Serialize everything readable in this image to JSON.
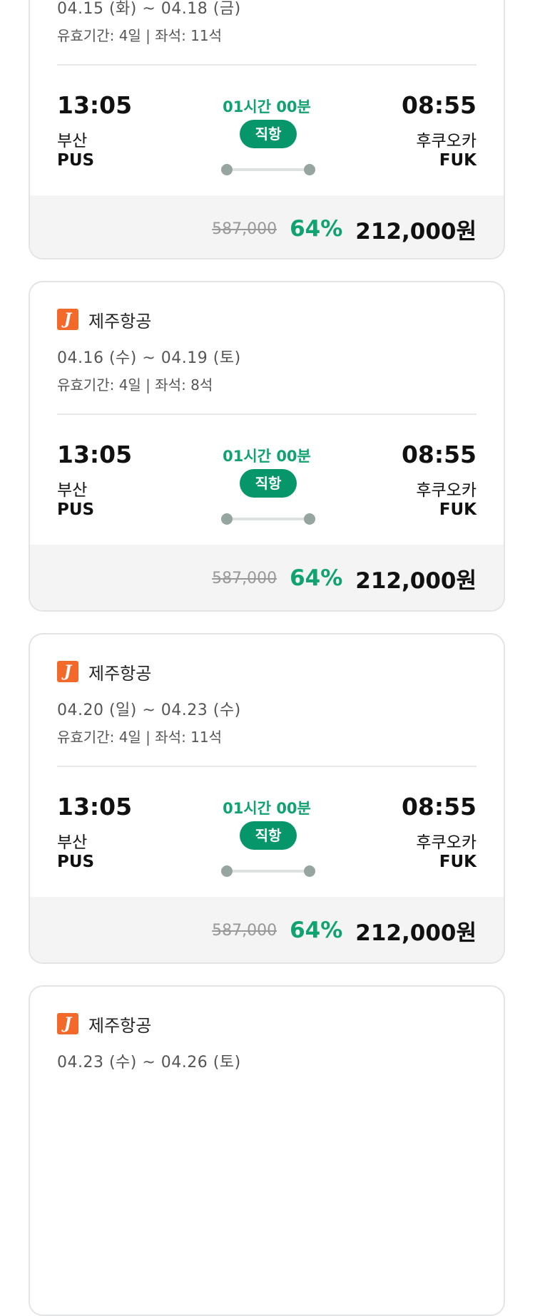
{
  "cards": [
    {
      "airline": "",
      "dates": "04.15 (화) ~ 04.18 (금)",
      "validity": "유효기간: 4일 | 좌석: 11석",
      "dep_time": "13:05",
      "dep_city": "부산",
      "dep_code": "PUS",
      "duration": "01시간 00분",
      "flight_type": "직항",
      "arr_time": "08:55",
      "arr_city": "후쿠오카",
      "arr_code": "FUK",
      "original_price": "587,000",
      "discount": "64%",
      "final_price": "212,000원"
    },
    {
      "airline": "제주항공",
      "dates": "04.16 (수) ~ 04.19 (토)",
      "validity": "유효기간: 4일 | 좌석: 8석",
      "dep_time": "13:05",
      "dep_city": "부산",
      "dep_code": "PUS",
      "duration": "01시간 00분",
      "flight_type": "직항",
      "arr_time": "08:55",
      "arr_city": "후쿠오카",
      "arr_code": "FUK",
      "original_price": "587,000",
      "discount": "64%",
      "final_price": "212,000원"
    },
    {
      "airline": "제주항공",
      "dates": "04.20 (일) ~ 04.23 (수)",
      "validity": "유효기간: 4일 | 좌석: 11석",
      "dep_time": "13:05",
      "dep_city": "부산",
      "dep_code": "PUS",
      "duration": "01시간 00분",
      "flight_type": "직항",
      "arr_time": "08:55",
      "arr_city": "후쿠오카",
      "arr_code": "FUK",
      "original_price": "587,000",
      "discount": "64%",
      "final_price": "212,000원"
    },
    {
      "airline": "제주항공",
      "dates": "04.23 (수) ~ 04.26 (토)"
    }
  ],
  "logo_letter": "J",
  "colors": {
    "accent": "#11a271",
    "badge": "#079669",
    "logo": "#f2692a",
    "price_bar": "#f4f4f4"
  }
}
